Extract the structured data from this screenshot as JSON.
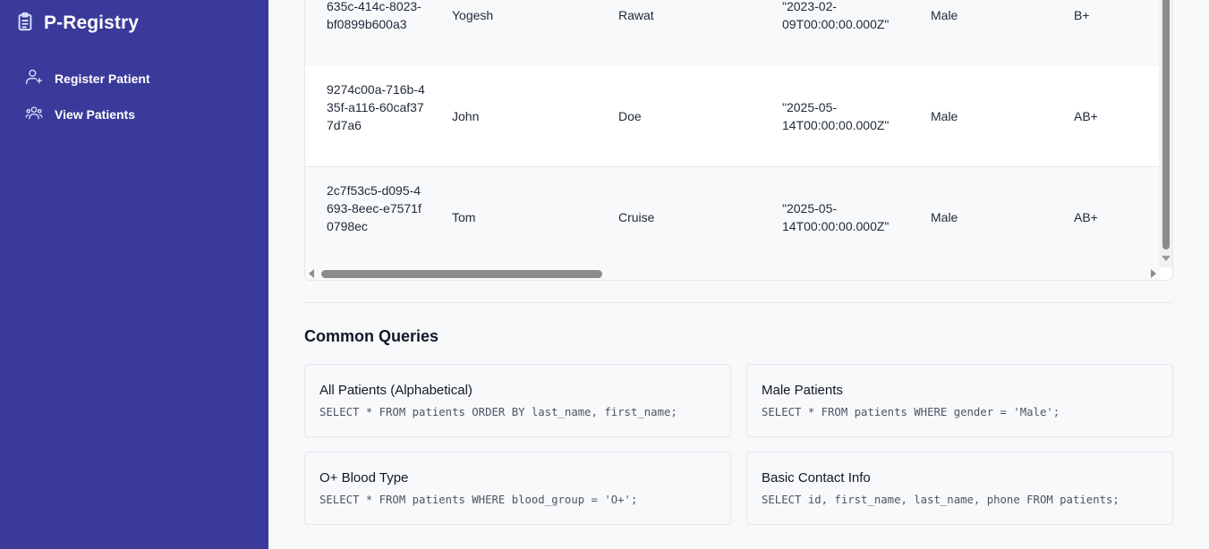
{
  "app": {
    "title": "P-Registry"
  },
  "nav": [
    {
      "label": "Register Patient",
      "icon": "user-plus-icon"
    },
    {
      "label": "View Patients",
      "icon": "users-icon"
    }
  ],
  "table": {
    "rows": [
      {
        "id": "635c-414c-8023-bf0899b600a3",
        "first_name": "Yogesh",
        "last_name": "Rawat",
        "dob": "\"2023-02-09T00:00:00.000Z\"",
        "gender": "Male",
        "blood_group": "B+"
      },
      {
        "id": "9274c00a-716b-435f-a116-60caf377d7a6",
        "first_name": "John",
        "last_name": "Doe",
        "dob": "\"2025-05-14T00:00:00.000Z\"",
        "gender": "Male",
        "blood_group": "AB+"
      },
      {
        "id": "2c7f53c5-d095-4693-8eec-e7571f0798ec",
        "first_name": "Tom",
        "last_name": "Cruise",
        "dob": "\"2025-05-14T00:00:00.000Z\"",
        "gender": "Male",
        "blood_group": "AB+"
      }
    ]
  },
  "queries": {
    "title": "Common Queries",
    "items": [
      {
        "title": "All Patients (Alphabetical)",
        "sql": "SELECT * FROM patients ORDER BY last_name, first_name;"
      },
      {
        "title": "Male Patients",
        "sql": "SELECT * FROM patients WHERE gender = 'Male';"
      },
      {
        "title": "O+ Blood Type",
        "sql": "SELECT * FROM patients WHERE blood_group = 'O+';"
      },
      {
        "title": "Basic Contact Info",
        "sql": "SELECT id, first_name, last_name, phone FROM patients;"
      }
    ]
  },
  "colors": {
    "sidebar": "#3a3a9a",
    "background": "#f8f9fb",
    "border": "#e5e7eb"
  }
}
